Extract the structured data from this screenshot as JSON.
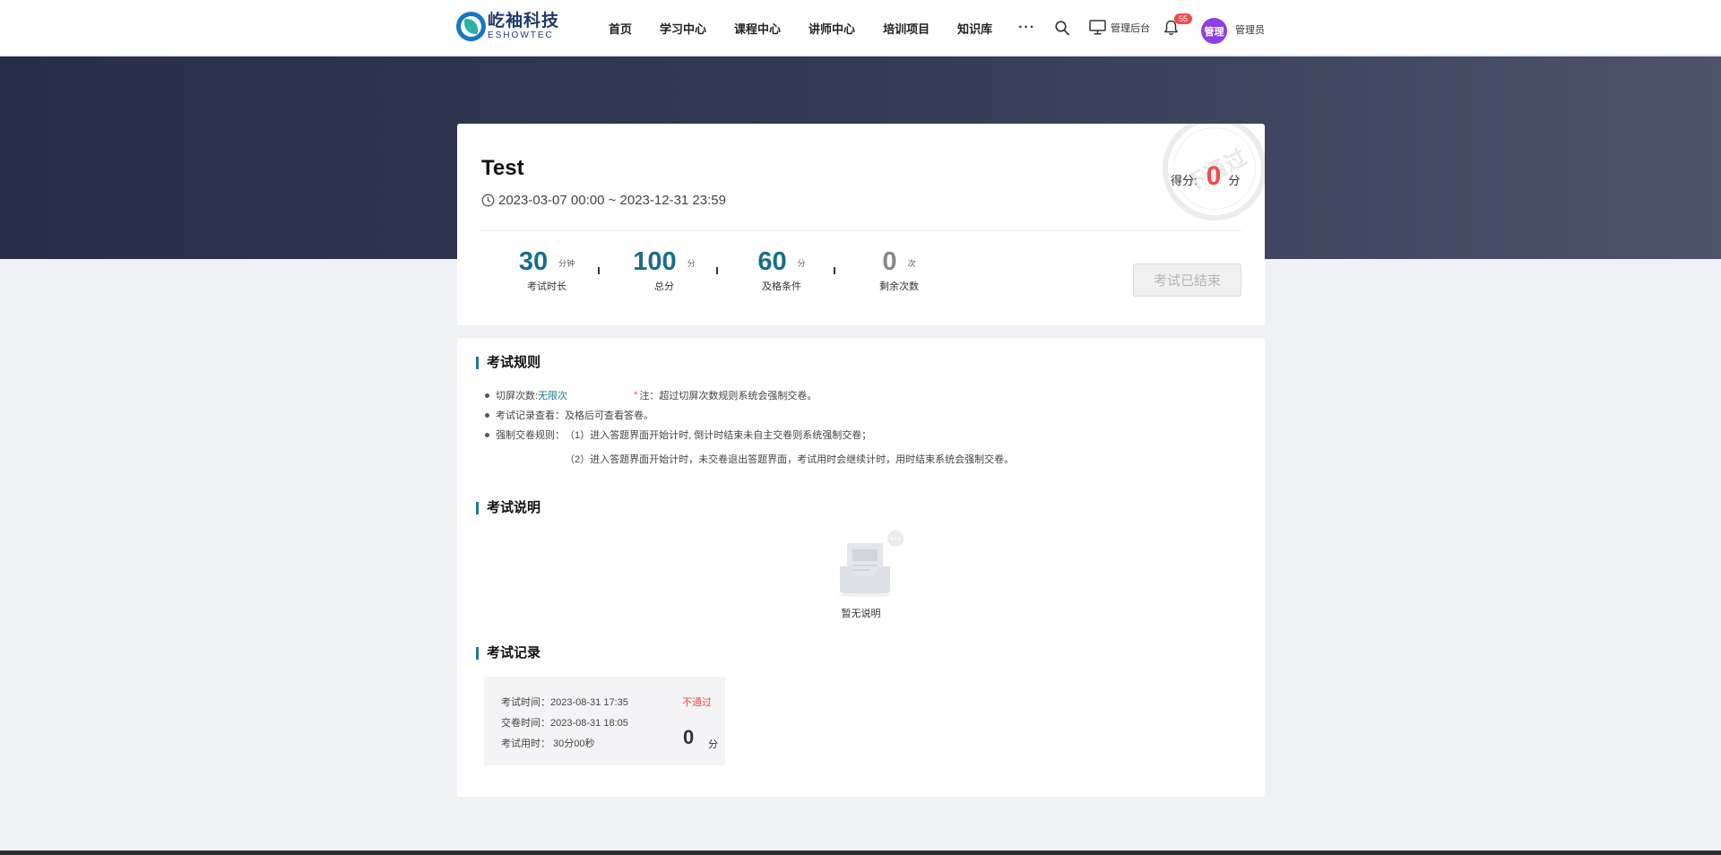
{
  "brand": {
    "name_cn": "屹袖科技",
    "name_en": "ESHOWTEC"
  },
  "nav": {
    "items": [
      "首页",
      "学习中心",
      "课程中心",
      "讲师中心",
      "培训项目",
      "知识库"
    ],
    "more": "···"
  },
  "header": {
    "admin_label": "管理后台",
    "notification_count": "55",
    "avatar_text": "管理",
    "username": "管理员"
  },
  "colors": {
    "accent": "#1a6d8a",
    "danger": "#f5484b",
    "avatar": "#8d3fe6",
    "banner": "#2b334c"
  },
  "exam": {
    "title": "Test",
    "time_range": "2023-03-07 00:00 ~ 2023-12-31 23:59",
    "stamp_text": "不通过",
    "score_label": "得分:",
    "score_value": "0",
    "score_unit": "分",
    "stats": [
      {
        "value": "30",
        "unit": "分钟",
        "caption": "考试时长"
      },
      {
        "value": "100",
        "unit": "分",
        "caption": "总分"
      },
      {
        "value": "60",
        "unit": "分",
        "caption": "及格条件"
      },
      {
        "value": "0",
        "unit": "次",
        "caption": "剩余次数"
      }
    ],
    "end_button": "考试已结束"
  },
  "rules": {
    "title": "考试规则",
    "switch_label": "切屏次数:",
    "switch_value": "无限次",
    "switch_note_mark": "*",
    "switch_note": "注：超过切屏次数规则系统会强制交卷。",
    "record_view": "考试记录查看：及格后可查看答卷。",
    "force_label": "强制交卷规则：",
    "force_1": "（1）进入答题界面开始计时, 倒计时结束未自主交卷则系统强制交卷；",
    "force_2": "（2）进入答题界面开始计时，未交卷退出答题界面，考试用时会继续计时，用时结束系统会强制交卷。"
  },
  "description": {
    "title": "考试说明",
    "empty_text": "暂无说明"
  },
  "records": {
    "title": "考试记录",
    "items": [
      {
        "start": "考试时间：2023-08-31 17:35",
        "submit": "交卷时间：2023-08-31 18:05",
        "duration": "考试用时： 30分00秒",
        "status": "不通过",
        "score": "0",
        "unit": "分"
      }
    ]
  }
}
